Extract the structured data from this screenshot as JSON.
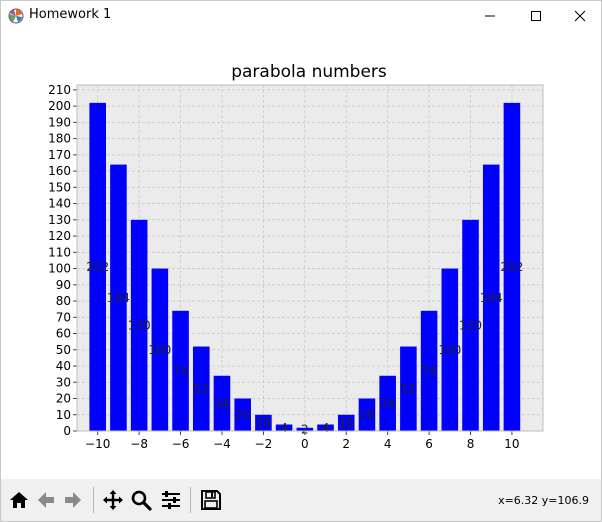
{
  "window": {
    "title": "Homework 1"
  },
  "chart_data": {
    "type": "bar",
    "title": "parabola numbers",
    "xlabel": "",
    "ylabel": "",
    "x": [
      -10,
      -9,
      -8,
      -7,
      -6,
      -5,
      -4,
      -3,
      -2,
      -1,
      0,
      1,
      2,
      3,
      4,
      5,
      6,
      7,
      8,
      9,
      10
    ],
    "values": [
      202,
      164,
      130,
      100,
      74,
      52,
      34,
      20,
      10,
      4,
      2,
      4,
      10,
      20,
      34,
      52,
      74,
      100,
      130,
      164,
      202
    ],
    "xticks": [
      -10,
      -8,
      -6,
      -4,
      -2,
      0,
      2,
      4,
      6,
      8,
      10
    ],
    "xtick_labels": [
      "−10",
      "−8",
      "−6",
      "−4",
      "−2",
      "0",
      "2",
      "4",
      "6",
      "8",
      "10"
    ],
    "yticks": [
      0,
      10,
      20,
      30,
      40,
      50,
      60,
      70,
      80,
      90,
      100,
      110,
      120,
      130,
      140,
      150,
      160,
      170,
      180,
      190,
      200,
      210
    ],
    "xlim": [
      -11,
      11.5
    ],
    "ylim": [
      0,
      213
    ],
    "grid": true,
    "bar_color": "#0000ff",
    "axes_facecolor": "#ebebeb",
    "label_color": "#222222"
  },
  "toolbar": {
    "coords_text": "x=6.32 y=106.9",
    "tools": [
      "home-icon",
      "back-icon",
      "forward-icon",
      "pan-icon",
      "zoom-icon",
      "configure-icon",
      "save-icon"
    ]
  }
}
